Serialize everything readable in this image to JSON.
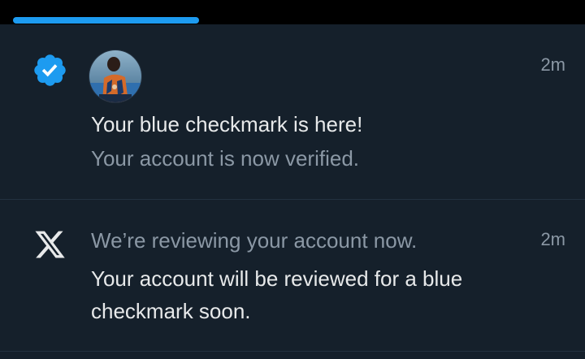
{
  "theme": {
    "background": "#15202b",
    "accent": "#1d9bf0",
    "text_primary": "#e7e9ea",
    "text_secondary": "#8b98a5"
  },
  "notifications": [
    {
      "icon": "verified-badge-icon",
      "avatar": "profile-avatar",
      "time": "2m",
      "title": "Your blue checkmark is here!",
      "subtitle": "Your account is now verified."
    },
    {
      "icon": "x-logo-icon",
      "time": "2m",
      "title": "We’re reviewing your account now.",
      "body": "Your account will be reviewed for a blue checkmark soon."
    }
  ]
}
